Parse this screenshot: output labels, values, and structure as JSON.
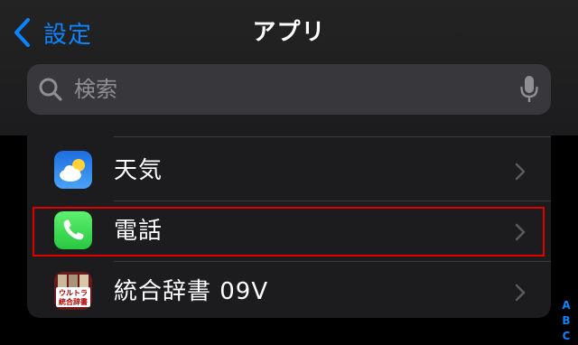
{
  "nav": {
    "back_label": "設定",
    "title": "アプリ"
  },
  "search": {
    "placeholder": "検索"
  },
  "list": {
    "items": [
      {
        "label": "天気",
        "icon": "weather-icon"
      },
      {
        "label": "電話",
        "icon": "phone-icon"
      },
      {
        "label": "統合辞書 09V",
        "icon": "dictionary-icon"
      }
    ]
  },
  "dictionary_icon_text": [
    "ウルトラ",
    "統合辞書"
  ],
  "index": [
    "A",
    "B",
    "C"
  ],
  "colors": {
    "accent": "#0a84ff",
    "highlight": "#e00000",
    "phone_green": "#34c759",
    "weather_blue": "#1e6fd9"
  }
}
